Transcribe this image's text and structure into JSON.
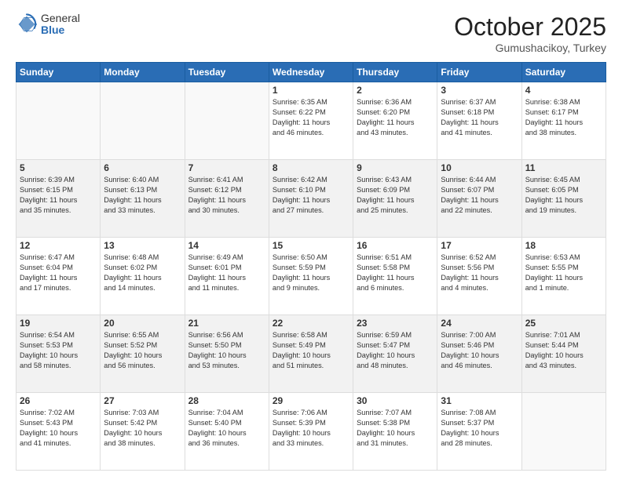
{
  "header": {
    "logo_general": "General",
    "logo_blue": "Blue",
    "month_title": "October 2025",
    "location": "Gumushacikoy, Turkey"
  },
  "weekdays": [
    "Sunday",
    "Monday",
    "Tuesday",
    "Wednesday",
    "Thursday",
    "Friday",
    "Saturday"
  ],
  "weeks": [
    [
      {
        "day": "",
        "info": ""
      },
      {
        "day": "",
        "info": ""
      },
      {
        "day": "",
        "info": ""
      },
      {
        "day": "1",
        "info": "Sunrise: 6:35 AM\nSunset: 6:22 PM\nDaylight: 11 hours\nand 46 minutes."
      },
      {
        "day": "2",
        "info": "Sunrise: 6:36 AM\nSunset: 6:20 PM\nDaylight: 11 hours\nand 43 minutes."
      },
      {
        "day": "3",
        "info": "Sunrise: 6:37 AM\nSunset: 6:18 PM\nDaylight: 11 hours\nand 41 minutes."
      },
      {
        "day": "4",
        "info": "Sunrise: 6:38 AM\nSunset: 6:17 PM\nDaylight: 11 hours\nand 38 minutes."
      }
    ],
    [
      {
        "day": "5",
        "info": "Sunrise: 6:39 AM\nSunset: 6:15 PM\nDaylight: 11 hours\nand 35 minutes."
      },
      {
        "day": "6",
        "info": "Sunrise: 6:40 AM\nSunset: 6:13 PM\nDaylight: 11 hours\nand 33 minutes."
      },
      {
        "day": "7",
        "info": "Sunrise: 6:41 AM\nSunset: 6:12 PM\nDaylight: 11 hours\nand 30 minutes."
      },
      {
        "day": "8",
        "info": "Sunrise: 6:42 AM\nSunset: 6:10 PM\nDaylight: 11 hours\nand 27 minutes."
      },
      {
        "day": "9",
        "info": "Sunrise: 6:43 AM\nSunset: 6:09 PM\nDaylight: 11 hours\nand 25 minutes."
      },
      {
        "day": "10",
        "info": "Sunrise: 6:44 AM\nSunset: 6:07 PM\nDaylight: 11 hours\nand 22 minutes."
      },
      {
        "day": "11",
        "info": "Sunrise: 6:45 AM\nSunset: 6:05 PM\nDaylight: 11 hours\nand 19 minutes."
      }
    ],
    [
      {
        "day": "12",
        "info": "Sunrise: 6:47 AM\nSunset: 6:04 PM\nDaylight: 11 hours\nand 17 minutes."
      },
      {
        "day": "13",
        "info": "Sunrise: 6:48 AM\nSunset: 6:02 PM\nDaylight: 11 hours\nand 14 minutes."
      },
      {
        "day": "14",
        "info": "Sunrise: 6:49 AM\nSunset: 6:01 PM\nDaylight: 11 hours\nand 11 minutes."
      },
      {
        "day": "15",
        "info": "Sunrise: 6:50 AM\nSunset: 5:59 PM\nDaylight: 11 hours\nand 9 minutes."
      },
      {
        "day": "16",
        "info": "Sunrise: 6:51 AM\nSunset: 5:58 PM\nDaylight: 11 hours\nand 6 minutes."
      },
      {
        "day": "17",
        "info": "Sunrise: 6:52 AM\nSunset: 5:56 PM\nDaylight: 11 hours\nand 4 minutes."
      },
      {
        "day": "18",
        "info": "Sunrise: 6:53 AM\nSunset: 5:55 PM\nDaylight: 11 hours\nand 1 minute."
      }
    ],
    [
      {
        "day": "19",
        "info": "Sunrise: 6:54 AM\nSunset: 5:53 PM\nDaylight: 10 hours\nand 58 minutes."
      },
      {
        "day": "20",
        "info": "Sunrise: 6:55 AM\nSunset: 5:52 PM\nDaylight: 10 hours\nand 56 minutes."
      },
      {
        "day": "21",
        "info": "Sunrise: 6:56 AM\nSunset: 5:50 PM\nDaylight: 10 hours\nand 53 minutes."
      },
      {
        "day": "22",
        "info": "Sunrise: 6:58 AM\nSunset: 5:49 PM\nDaylight: 10 hours\nand 51 minutes."
      },
      {
        "day": "23",
        "info": "Sunrise: 6:59 AM\nSunset: 5:47 PM\nDaylight: 10 hours\nand 48 minutes."
      },
      {
        "day": "24",
        "info": "Sunrise: 7:00 AM\nSunset: 5:46 PM\nDaylight: 10 hours\nand 46 minutes."
      },
      {
        "day": "25",
        "info": "Sunrise: 7:01 AM\nSunset: 5:44 PM\nDaylight: 10 hours\nand 43 minutes."
      }
    ],
    [
      {
        "day": "26",
        "info": "Sunrise: 7:02 AM\nSunset: 5:43 PM\nDaylight: 10 hours\nand 41 minutes."
      },
      {
        "day": "27",
        "info": "Sunrise: 7:03 AM\nSunset: 5:42 PM\nDaylight: 10 hours\nand 38 minutes."
      },
      {
        "day": "28",
        "info": "Sunrise: 7:04 AM\nSunset: 5:40 PM\nDaylight: 10 hours\nand 36 minutes."
      },
      {
        "day": "29",
        "info": "Sunrise: 7:06 AM\nSunset: 5:39 PM\nDaylight: 10 hours\nand 33 minutes."
      },
      {
        "day": "30",
        "info": "Sunrise: 7:07 AM\nSunset: 5:38 PM\nDaylight: 10 hours\nand 31 minutes."
      },
      {
        "day": "31",
        "info": "Sunrise: 7:08 AM\nSunset: 5:37 PM\nDaylight: 10 hours\nand 28 minutes."
      },
      {
        "day": "",
        "info": ""
      }
    ]
  ]
}
